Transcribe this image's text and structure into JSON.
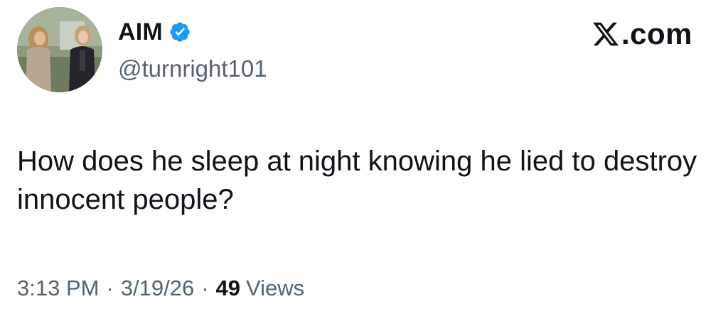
{
  "author": {
    "display_name": "AIM",
    "handle": "@turnright101",
    "verified": true,
    "avatar": "profile-photo"
  },
  "brand": {
    "label": ".com",
    "icon": "x-logo-icon"
  },
  "tweet": {
    "text": "How does he sleep at night knowing he lied to destroy innocent people?",
    "time": "3:13 PM",
    "date": "3/19/26",
    "separator": "·",
    "views_count": "49",
    "views_label": "Views"
  },
  "colors": {
    "text_primary": "#0f1419",
    "text_secondary": "#536471",
    "verified_blue": "#1d9bf0"
  }
}
